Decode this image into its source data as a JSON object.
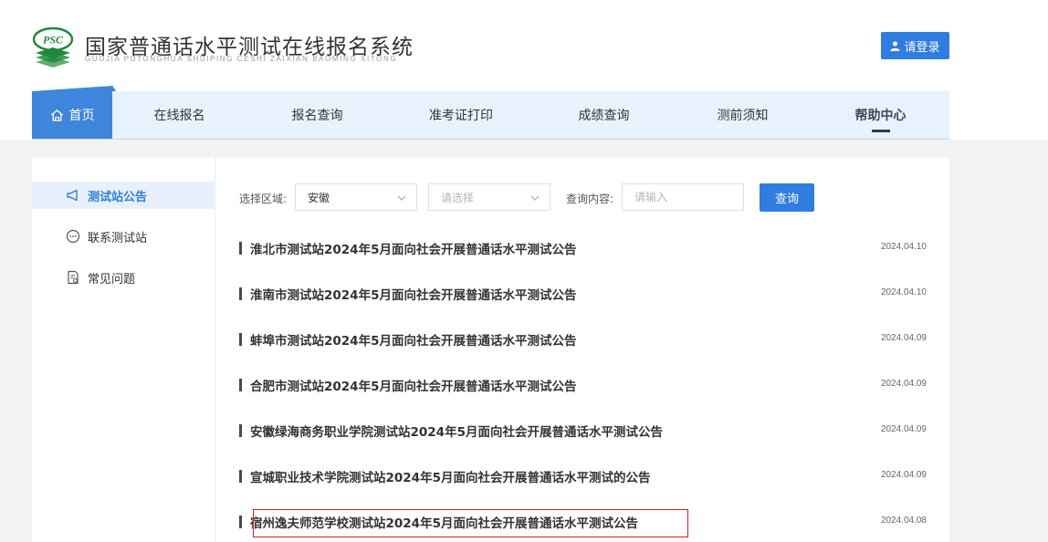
{
  "header": {
    "logo_text": "PSC",
    "title": "国家普通话水平测试在线报名系统",
    "subtitle": "GUOJIA PUTONGHUA SHUIPING CESHI ZAIXIAN BAOMING XITONG",
    "login_label": "请登录"
  },
  "nav": {
    "items": [
      {
        "label": "首页",
        "icon": "home-icon"
      },
      {
        "label": "在线报名"
      },
      {
        "label": "报名查询"
      },
      {
        "label": "准考证打印"
      },
      {
        "label": "成绩查询"
      },
      {
        "label": "测前须知"
      },
      {
        "label": "帮助中心"
      }
    ],
    "active_index": 0,
    "current_section_index": 6
  },
  "sidebar": {
    "items": [
      {
        "label": "测试站公告",
        "icon": "megaphone-icon"
      },
      {
        "label": "联系测试站",
        "icon": "chat-icon"
      },
      {
        "label": "常见问题",
        "icon": "document-question-icon"
      }
    ],
    "active_index": 0
  },
  "filters": {
    "region_label": "选择区域:",
    "region_value": "安徽",
    "city_placeholder": "请选择",
    "content_label": "查询内容:",
    "content_placeholder": "请输入",
    "search_label": "查询"
  },
  "notices": [
    {
      "title": "淮北市测试站2024年5月面向社会开展普通话水平测试公告",
      "date": "2024.04.10"
    },
    {
      "title": "淮南市测试站2024年5月面向社会开展普通话水平测试公告",
      "date": "2024.04.10"
    },
    {
      "title": "蚌埠市测试站2024年5月面向社会开展普通话水平测试公告",
      "date": "2024.04.09"
    },
    {
      "title": "合肥市测试站2024年5月面向社会开展普通话水平测试公告",
      "date": "2024.04.09"
    },
    {
      "title": "安徽绿海商务职业学院测试站2024年5月面向社会开展普通话水平测试公告",
      "date": "2024.04.09"
    },
    {
      "title": "宣城职业技术学院测试站2024年5月面向社会开展普通话水平测试的公告",
      "date": "2024.04.09"
    },
    {
      "title": "宿州逸夫师范学校测试站2024年5月面向社会开展普通话水平测试公告",
      "date": "2024.04.08"
    }
  ],
  "colors": {
    "accent": "#2f7de1",
    "nav_bg": "#e8f2fc",
    "highlight": "#d61f1f",
    "logo_green": "#1f8a3c"
  }
}
